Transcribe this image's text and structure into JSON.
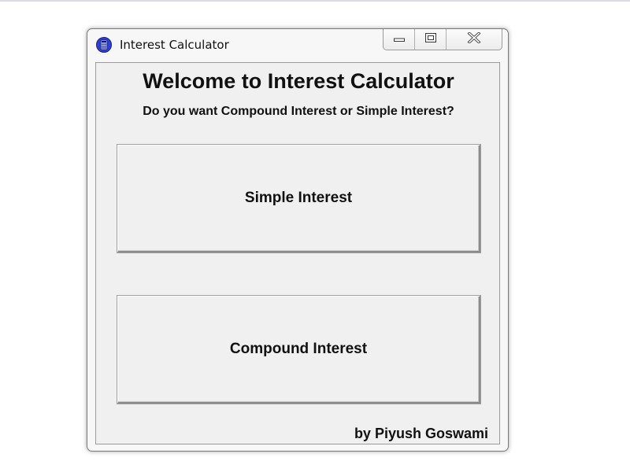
{
  "window": {
    "title": "Interest Calculator",
    "app_icon": "calculator-icon",
    "controls": {
      "minimize_icon": "minimize-icon",
      "maximize_icon": "maximize-icon",
      "close_icon": "close-icon"
    }
  },
  "content": {
    "heading": "Welcome to Interest Calculator",
    "question": "Do you want Compound Interest or Simple Interest?",
    "buttons": {
      "simple": "Simple Interest",
      "compound": "Compound Interest"
    },
    "author": "by Piyush Goswami"
  },
  "colors": {
    "app_icon_blue": "#2f3fd0",
    "client_background": "#f0f0f0",
    "text": "#111111"
  }
}
